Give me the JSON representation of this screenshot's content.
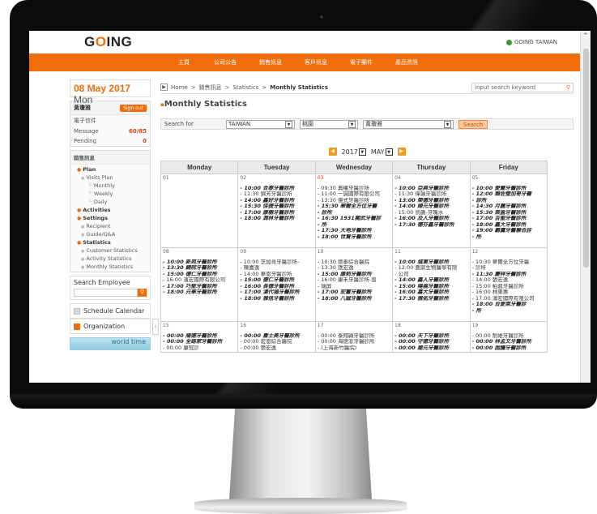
{
  "app": {
    "logo_a": "G",
    "logo_b": "O",
    "logo_c": "ING",
    "region": "GOING TAIWAN"
  },
  "nav": [
    "主頁",
    "公司公告",
    "銷售訊息",
    "客戶訊息",
    "電子郵件",
    "產品資訊"
  ],
  "sidebar": {
    "date": "08 May 2017",
    "weekday": "Mon",
    "user": {
      "name": "黃瓊雅",
      "signout": "Sign out"
    },
    "mail_label": "電子信件",
    "message_label": "Message",
    "message_count": "60/85",
    "pending_label": "Pending",
    "pending_count": "0",
    "sales_title": "銷售訊息",
    "menu": [
      {
        "label": "Plan",
        "level": "sec"
      },
      {
        "label": "Visits Plan",
        "level": "l2"
      },
      {
        "label": "Monthly",
        "level": "l3"
      },
      {
        "label": "Weekly",
        "level": "l3"
      },
      {
        "label": "Daily",
        "level": "l3"
      },
      {
        "label": "Activities",
        "level": "sec"
      },
      {
        "label": "Settings",
        "level": "sec"
      },
      {
        "label": "Recipient",
        "level": "l2"
      },
      {
        "label": "Guide/Q&A",
        "level": "l2"
      },
      {
        "label": "Statistics",
        "level": "sec"
      },
      {
        "label": "Customer Statistics",
        "level": "l2"
      },
      {
        "label": "Activity Statistics",
        "level": "l2"
      },
      {
        "label": "Monthly Statistics",
        "level": "l2"
      }
    ],
    "search_employee": "Search Employee",
    "schedule": "Schedule Calendar",
    "organization": "Organization",
    "world_time": "world time"
  },
  "breadcrumb": {
    "home": "Home",
    "sep": ">",
    "c1": "銷售訊息",
    "c2": "Statistics",
    "current": "Monthly Statistics"
  },
  "search": {
    "placeholder": "input search keyword"
  },
  "page_title": "Monthly Statistics",
  "filter": {
    "label": "Search for",
    "country": "TAIWAN",
    "city": "桃園",
    "person": "黃瓊雅",
    "button": "Search"
  },
  "month": {
    "year": "2017",
    "month": "MAY"
  },
  "calendar": {
    "headers": [
      "Monday",
      "Tuesday",
      "Wednesday",
      "Thursday",
      "Friday"
    ],
    "weeks": [
      [
        {
          "day": "01",
          "events": []
        },
        {
          "day": "02",
          "events": [
            [
              "10:00 合泰牙醫診所",
              1
            ],
            [
              "11:30 錦芳牙醫診所",
              0
            ],
            [
              "14:00 鑫好牙醫診所",
              1
            ],
            [
              "15:30 佳捷牙醫診所",
              1
            ],
            [
              "17:00 康樹牙醫診所",
              1
            ],
            [
              "18:00 潤林牙醫診所",
              1
            ]
          ]
        },
        {
          "day": "03",
          "red": 1,
          "events": [
            [
              "09:30 典權牙醫診所",
              0
            ],
            [
              "11:00 一誠國際有限公司",
              0
            ],
            [
              "13:30 億式牙醫診所",
              0
            ],
            [
              "15:30 華爾全方位牙醫",
              1
            ],
            [
              "診所",
              1
            ],
            [
              "16:30 1931閣武牙醫診",
              1
            ],
            [
              "所",
              1
            ],
            [
              "17:30 大地牙醫診所",
              1
            ],
            [
              "18:00 世賢牙醫診所",
              1
            ]
          ]
        },
        {
          "day": "04",
          "events": [
            [
              "10:00 亞典牙醫診所",
              1
            ],
            [
              "11:30 偉瑞牙醫診所",
              0
            ],
            [
              "13:00 榮德牙醫診所",
              1
            ],
            [
              "14:00 婦元牙醫診所",
              1
            ],
            [
              "15:00 烏鵲-牙嘴水",
              0
            ],
            [
              "16:00 及人牙醫診所",
              1
            ],
            [
              "17:30 德芬鑫牙醫診所",
              1
            ]
          ]
        },
        {
          "day": "05",
          "events": [
            [
              "10:00 愛蘭牙醫診所",
              1
            ],
            [
              "12:00 賴佐瑩加哥牙醫",
              1
            ],
            [
              "診所",
              1
            ],
            [
              "14:30 月麗牙醫診所",
              1
            ],
            [
              "15:30 萊盈牙醫診所",
              1
            ],
            [
              "17:00 吉聖牙醫診所",
              1
            ],
            [
              "18:00 鑫大牙醫診所",
              1
            ],
            [
              "19:00 霸鷹牙醫聯合診",
              1
            ],
            [
              "所",
              1
            ]
          ]
        }
      ],
      [
        {
          "day": "08",
          "events": [
            [
              "10:00 新苑牙醫診所",
              1
            ],
            [
              "13:30 錦院牙醫診所",
              1
            ],
            [
              "15:00 德仁牙醫診所",
              1
            ],
            [
              "16:00 濱宏國際有限公司",
              0
            ],
            [
              "17:00 巧堅牙醫診所",
              1
            ],
            [
              "18:00 元華牙醫診所",
              1
            ]
          ]
        },
        {
          "day": "09",
          "events": [
            [
              "10:00 芝加哥牙醫診所-",
              0
            ],
            [
              "陳嘉逸",
              0
            ],
            [
              "14:00 華恩牙醫診所",
              0
            ],
            [
              "15:00 德仁牙醫診所",
              1
            ],
            [
              "16:00 長德牙醫診所",
              1
            ],
            [
              "17:00 漢代福牙醫診所",
              1
            ],
            [
              "18:00 雅信牙醫診所",
              1
            ]
          ]
        },
        {
          "day": "10",
          "events": [
            [
              "10:30 德泰綜合醫院",
              0
            ],
            [
              "13:30 張宏逸",
              0
            ],
            [
              "15:00 康莉牙醫診所",
              1
            ],
            [
              "16:00 康禾牙醫診所-曾",
              0
            ],
            [
              "瑞屏",
              0
            ],
            [
              "17:00 宏璽牙醫診所",
              1
            ],
            [
              "18:00 八誠牙醫診所",
              1
            ]
          ]
        },
        {
          "day": "11",
          "events": [
            [
              "10:00 城東牙醫診所",
              1
            ],
            [
              "12:00 藝鼎生物醫學有限",
              0
            ],
            [
              "公司",
              0
            ],
            [
              "14:00 鑫人牙醫診所",
              1
            ],
            [
              "15:00 陽展牙醫診所",
              1
            ],
            [
              "16:00 嘉大牙醫診所",
              1
            ],
            [
              "17:30 雅佑牙醫診所",
              1
            ]
          ]
        },
        {
          "day": "12",
          "events": [
            [
              "10:30 華爾全方位牙醫",
              0
            ],
            [
              "診所",
              0
            ],
            [
              "11:30 慶祥牙醫診所",
              1
            ],
            [
              "14:00 張宏逸",
              0
            ],
            [
              "15:00 柏鼎牙醫診所",
              0
            ],
            [
              "16:00 林東惠",
              0
            ],
            [
              "17:00 濱宏國際有限公司",
              0
            ],
            [
              "18:00 台愛萊牙醫診",
              1
            ],
            [
              "所",
              1
            ]
          ]
        }
      ],
      [
        {
          "day": "15",
          "events": [
            [
              "00:00 陽德牙醫診所",
              1
            ],
            [
              "00:00 全路家牙醫診所",
              1
            ],
            [
              "00:00 康冠診",
              0
            ]
          ]
        },
        {
          "day": "16",
          "events": [
            [
              "00:00 蓋士美牙醫診所",
              1
            ],
            [
              "00:00 宏恩綜合醫院",
              0
            ],
            [
              "00:00 張宏逸",
              0
            ]
          ]
        },
        {
          "day": "17",
          "events": [
            [
              "00:00 泰翔潁牙醫診所",
              0
            ],
            [
              "00:00 海德澎牙醫診所",
              0
            ],
            [
              "(上海新竹醫院)",
              0
            ]
          ]
        },
        {
          "day": "18",
          "events": [
            [
              "00:00 天下牙醫診所",
              1
            ],
            [
              "00:00 守德牙醫診所",
              1
            ],
            [
              "00:00 建元牙醫診所",
              1
            ]
          ]
        },
        {
          "day": "19",
          "events": [
            [
              "00:00 耐維牙醫診所",
              0
            ],
            [
              "00:00 林孟文牙醫診所",
              1
            ],
            [
              "00:00 固騰牙醫診所",
              1
            ]
          ]
        }
      ]
    ]
  }
}
